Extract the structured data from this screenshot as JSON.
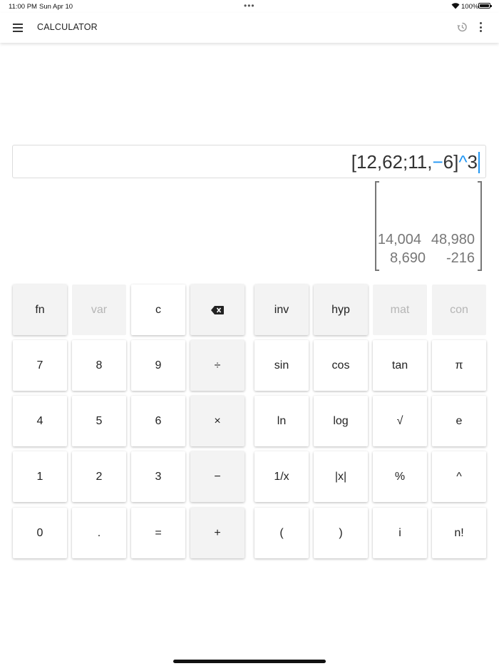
{
  "status_bar": {
    "time": "11:00 PM",
    "date": "Sun Apr 10",
    "battery": "100%"
  },
  "app_bar": {
    "title": "CALCULATOR",
    "icons": [
      "menu-icon",
      "history-icon",
      "overflow-menu-icon"
    ]
  },
  "expression": {
    "part1": "[12,62;11,",
    "minus": "−",
    "part2": "6]",
    "caret_op": "^",
    "part3": "3"
  },
  "result": {
    "r1c1": "14,004",
    "r1c2": "48,980",
    "r2c1": "8,690",
    "r2c2": "-216"
  },
  "keys_left": [
    [
      "fn",
      "var",
      "c",
      ""
    ],
    [
      "7",
      "8",
      "9",
      "÷"
    ],
    [
      "4",
      "5",
      "6",
      "×"
    ],
    [
      "1",
      "2",
      "3",
      "−"
    ],
    [
      "0",
      ".",
      "=",
      "+"
    ]
  ],
  "keys_right": [
    [
      "inv",
      "hyp",
      "mat",
      "con"
    ],
    [
      "sin",
      "cos",
      "tan",
      "π"
    ],
    [
      "ln",
      "log",
      "√",
      "e"
    ],
    [
      "1/x",
      "|x|",
      "%",
      "^"
    ],
    [
      "(",
      ")",
      "i",
      "n!"
    ]
  ],
  "backspace_icon": "backspace-icon",
  "disabled_keys": [
    "var",
    "mat",
    "con"
  ]
}
